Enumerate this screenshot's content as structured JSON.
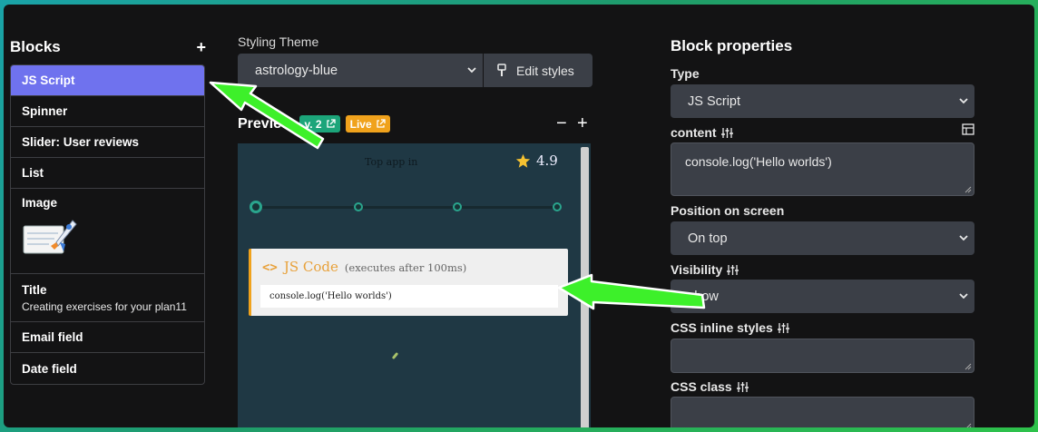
{
  "blocks": {
    "title": "Blocks",
    "add_label": "+",
    "items": [
      {
        "label": "JS Script"
      },
      {
        "label": "Spinner"
      },
      {
        "label": "Slider: User reviews"
      },
      {
        "label": "List"
      },
      {
        "label": "Image"
      },
      {
        "label": "Title",
        "sub": "Creating exercises for your plan11"
      },
      {
        "label": "Email field"
      },
      {
        "label": "Date field"
      }
    ]
  },
  "theme": {
    "label": "Styling Theme",
    "value": "astrology-blue",
    "edit_label": "Edit styles"
  },
  "preview": {
    "title": "Preview",
    "version": "v. 2",
    "live": "Live",
    "zoom_out": "−",
    "zoom_in": "+",
    "top_text": "Top app in",
    "rating": "4.9",
    "js_icon": "<>",
    "js_title": "JS Code",
    "js_note": "(executes after 100ms)",
    "js_code": "console.log('Hello worlds')"
  },
  "properties": {
    "title": "Block properties",
    "type_label": "Type",
    "type_value": "JS Script",
    "content_label": "content",
    "content_value": "console.log('Hello worlds')",
    "position_label": "Position on screen",
    "position_value": "On top",
    "visibility_label": "Visibility",
    "visibility_value": "show",
    "css_inline_label": "CSS inline styles",
    "css_inline_value": "",
    "css_class_label": "CSS class",
    "css_class_value": ""
  },
  "colors": {
    "accent": "#6f72ee",
    "live": "#f0a21c",
    "version": "#1ca57a",
    "arrow": "#3df02a"
  }
}
